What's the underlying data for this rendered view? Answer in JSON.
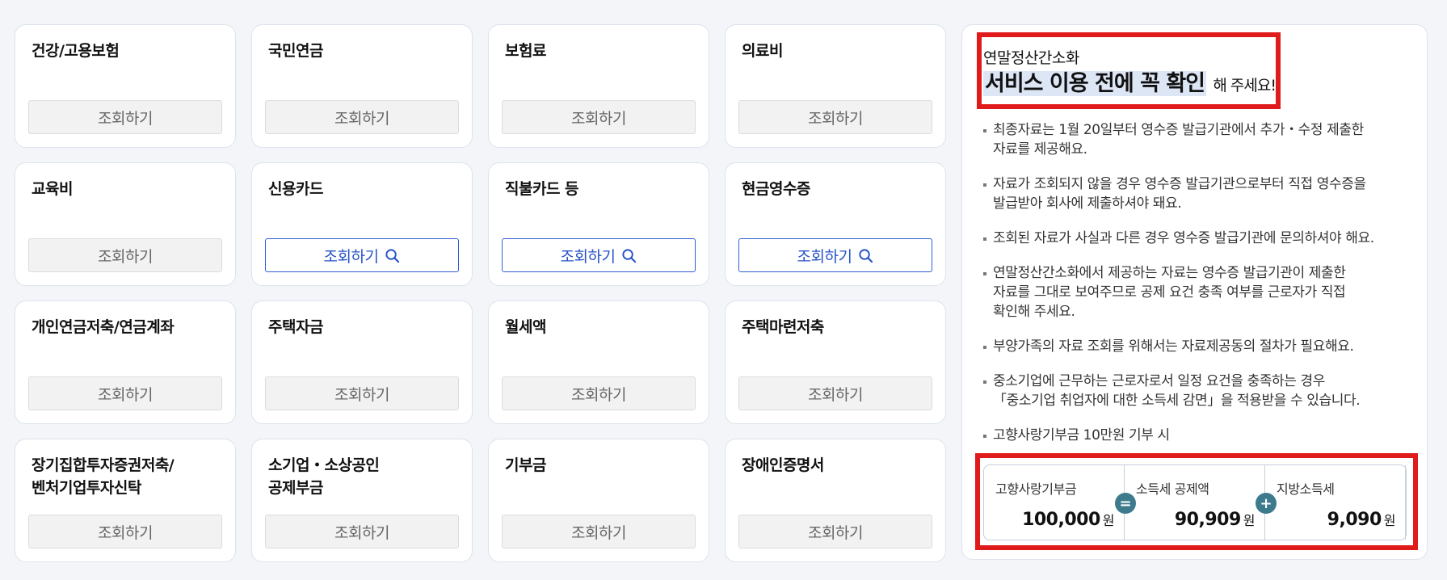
{
  "query_label": "조회하기",
  "cards": [
    {
      "title": "건강/고용보험",
      "active": false
    },
    {
      "title": "국민연금",
      "active": false
    },
    {
      "title": "보험료",
      "active": false
    },
    {
      "title": "의료비",
      "active": false
    },
    {
      "title": "교육비",
      "active": false
    },
    {
      "title": "신용카드",
      "active": true
    },
    {
      "title": "직불카드 등",
      "active": true
    },
    {
      "title": "현금영수증",
      "active": true
    },
    {
      "title": "개인연금저축/연금계좌",
      "active": false
    },
    {
      "title": "주택자금",
      "active": false
    },
    {
      "title": "월세액",
      "active": false
    },
    {
      "title": "주택마련저축",
      "active": false
    },
    {
      "title": "장기집합투자증권저축/\n벤처기업투자신탁",
      "active": false
    },
    {
      "title": "소기업・소상공인\n공제부금",
      "active": false
    },
    {
      "title": "기부금",
      "active": false
    },
    {
      "title": "장애인증명서",
      "active": false
    }
  ],
  "info": {
    "subtitle": "연말정산간소화",
    "headline": "서비스 이용 전에 꼭 확인",
    "headline_suffix": "해 주세요!",
    "notes": [
      "최종자료는 1월 20일부터 영수증 발급기관에서 추가・수정 제출한\n자료를 제공해요.",
      "자료가 조회되지 않을 경우 영수증 발급기관으로부터 직접 영수증을\n발급받아 회사에 제출하셔야 돼요.",
      "조회된 자료가 사실과 다른 경우 영수증 발급기관에 문의하셔야 해요.",
      "연말정산간소화에서 제공하는 자료는 영수증 발급기관이 제출한\n자료를 그대로 보여주므로 공제 요건 충족 여부를 근로자가 직접\n확인해 주세요.",
      "부양가족의 자료 조회를 위해서는 자료제공동의 절차가 필요해요.",
      "중소기업에 근무하는 근로자로서 일정 요건을 충족하는 경우\n「중소기업 취업자에 대한 소득세 감면」을 적용받을 수 있습니다.",
      "고향사랑기부금 10만원 기부 시"
    ],
    "calc": [
      {
        "label": "고향사랑기부금",
        "value": "100,000",
        "unit": "원"
      },
      {
        "label": "소득세 공제액",
        "value": "90,909",
        "unit": "원"
      },
      {
        "label": "지방소득세",
        "value": "9,090",
        "unit": "원"
      }
    ],
    "operators": [
      "=",
      "+"
    ]
  },
  "colors": {
    "accent": "#2553c7",
    "highlight_border": "#e01b1b",
    "operator_badge": "#3d7b8c"
  }
}
